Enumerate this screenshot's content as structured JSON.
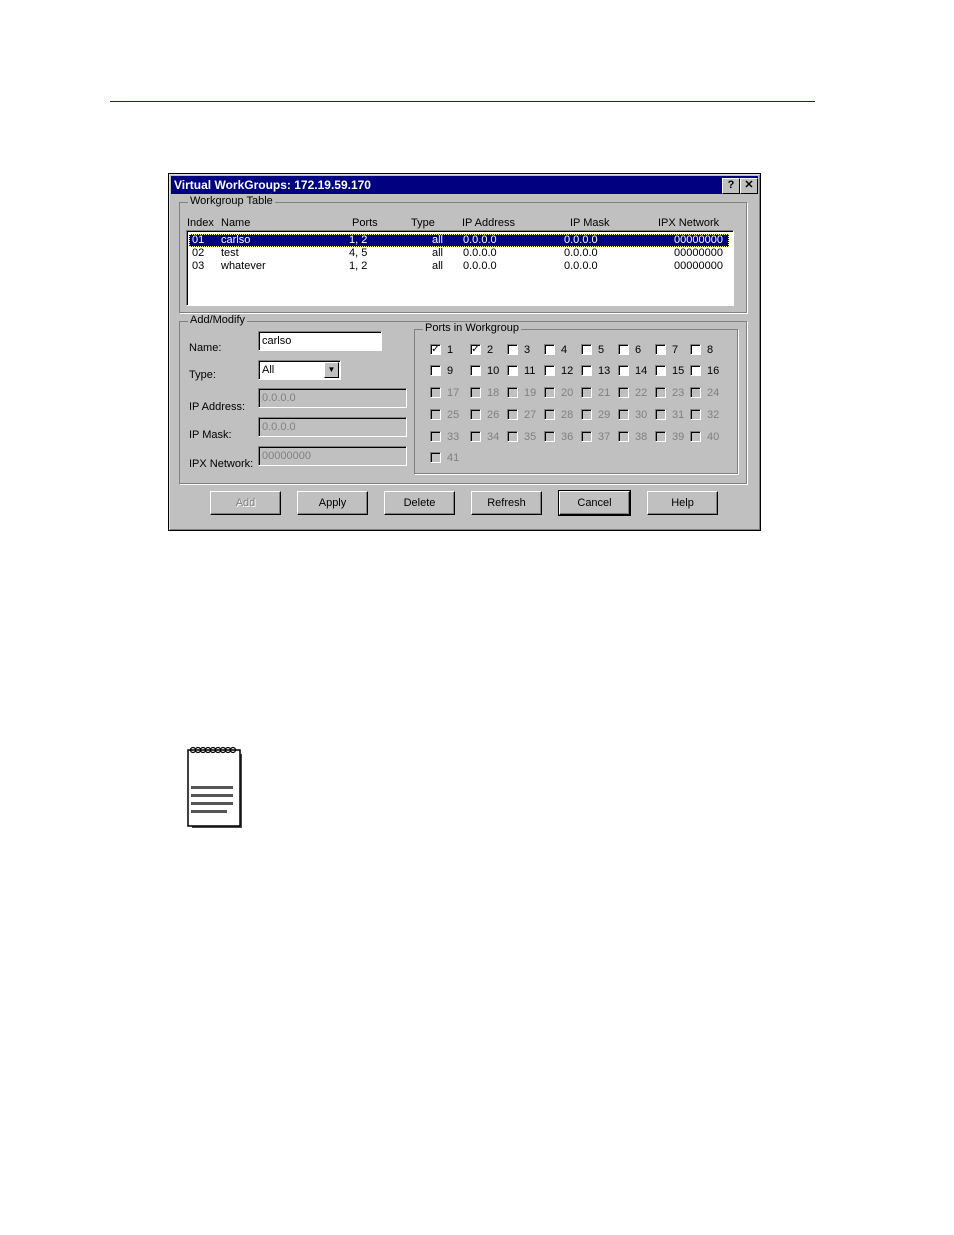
{
  "window": {
    "title": "Virtual WorkGroups: 172.19.59.170",
    "help_button": "?",
    "close_button": "✕"
  },
  "workgroup_table": {
    "label": "Workgroup Table",
    "columns": [
      "Index",
      "Name",
      "Ports",
      "Type",
      "IP Address",
      "IP Mask",
      "IPX Network"
    ],
    "rows": [
      {
        "index": "01",
        "name": "carlso",
        "ports": "1, 2",
        "type": "all",
        "ip": "0.0.0.0",
        "mask": "0.0.0.0",
        "ipx": "00000000",
        "selected": true
      },
      {
        "index": "02",
        "name": "test",
        "ports": "4, 5",
        "type": "all",
        "ip": "0.0.0.0",
        "mask": "0.0.0.0",
        "ipx": "00000000",
        "selected": false
      },
      {
        "index": "03",
        "name": "whatever",
        "ports": "1, 2",
        "type": "all",
        "ip": "0.0.0.0",
        "mask": "0.0.0.0",
        "ipx": "00000000",
        "selected": false
      }
    ]
  },
  "add_modify": {
    "label": "Add/Modify",
    "name_label": "Name:",
    "name_value": "carlso",
    "type_label": "Type:",
    "type_value": "All",
    "ip_label": "IP Address:",
    "ip_value": "0.0.0.0",
    "mask_label": "IP Mask:",
    "mask_value": "0.0.0.0",
    "ipx_label": "IPX Network:",
    "ipx_value": "00000000"
  },
  "ports": {
    "label": "Ports in Workgroup",
    "checked": [
      1,
      2
    ],
    "enabled_max": 16,
    "total": 41
  },
  "buttons": {
    "add": "Add",
    "apply": "Apply",
    "delete": "Delete",
    "refresh": "Refresh",
    "cancel": "Cancel",
    "help": "Help"
  }
}
